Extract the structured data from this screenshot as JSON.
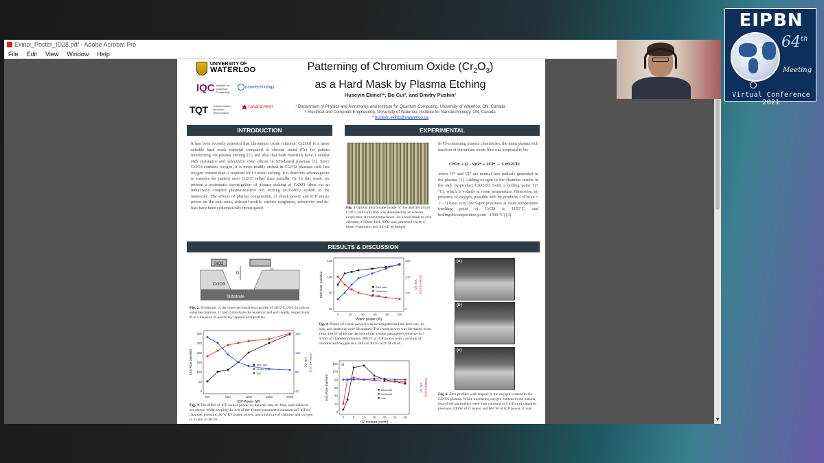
{
  "window": {
    "title": "Ekinci_Poster_ID28.pdf - Adobe Acrobat Pro",
    "menu": [
      "File",
      "Edit",
      "View",
      "Window",
      "Help"
    ]
  },
  "poster": {
    "title_line1": "Patterning of Chromium Oxide (Cr",
    "title_sub1": "2",
    "title_mid": "O",
    "title_sub2": "3",
    "title_end": ")",
    "title_line2": "as a Hard Mask by Plasma Etching",
    "authors": "Huseyin Ekinci¹*, Bo Cui², and Dmitry Pushin¹",
    "affil1": "¹ Department of Physics and Astronomy, and Institute for Quantum Computing, University of Waterloo, ON, Canada",
    "affil2": "² Electrical and Computer Engineering, University of Waterloo, Institute for Nanotechnology, ON, Canada",
    "email": "huseyin.ekinci@uwaterloo.ca",
    "logos": {
      "uw_small": "UNIVERSITY OF",
      "uw_big": "WATERLOO",
      "iqc": "IQC",
      "iqc_sub": "Institute for Quantum Computing",
      "nano": "nanotechnology",
      "tqt": "TQT",
      "tqt_sub": "Transformative Quantum Technologies",
      "cfref": "CANADA FIRST"
    },
    "intro_head": "INTRODUCTION",
    "intro_text": "It has been recently reported that chromium oxide (chrome, Cr2O3) is a more suitable hard mask material compared to chrome metal (Cr) for pattern transferring via plasma etching [1], and also that both materials have a similar etch resistance and selectivity over silicon in SF6-based plasmas [2]. Since Cr2O3 contains oxygen, it is more readily etched in Cl2/O2 plasmas with less oxygen content than is required for Cr metal etching. It is therefore advantageous to transfer the pattern onto Cr2O3 rather than metallic Cr. In this work, we present a systematic investigation of plasma etching of Cr2O3 films via an inductively coupled plasma-reactive ion etching (ICP-RIE) system in the nanoscale. The effects of plasma composition, rf chuck power and ICP source power on the etch rates, sidewall profile, surface roughness, selectivity and dc-bias have been systematically investigated.",
    "exp_head": "EXPERIMENTAL",
    "fig1_caption_bold": "Fig. 1",
    "fig1_caption": " Optical microscope image of line and dot arrays. Cr2O3 (500 nm) film was deposited by an e-beam evaporator at room temperature. As a hard mask to etch chromia, a 50nm-thick SiO2 was patterned via an e-beam evaporator and lift-off technique.",
    "exp_text1": "In Cl-containing plasma chemistries, the main plasma etch reaction of chromium oxide film was proposed to be:",
    "formula": "CrOx + (2 - x)O* + 2Cl* → CrO2Cl2",
    "exp_text2": "where O* and Cl* are neutral free radicals generated in the plasma [3]. Adding oxygen to the chamber results in the etch by-product CrO2Cl2 (with a boiling point 117 °C), which is volatile at room temperature. Otherwise, no presence of oxygen, possible etch by-products CrCln (n = 1 - 3) have very low vapor pressures at room temperature (melting point of CrCl3 is 1152°C, and boiling/decomposition point ~1300 °C) [3].",
    "results_head": "RESULTS & DISCUSSION",
    "fig2_caption_bold": "Fig. 2.",
    "fig2_caption": " Schematic of the cross-sectional etch profile of SiO2/Cr2O3 on silicon substrate features. U and D illustrate the undercut and etch depth, respectively. Θ is a measure of positively tapered etch profiles.",
    "fig3_caption_bold": "Fig. 3.",
    "fig3_caption": " The effect of ICP source power on the etch rate, dc-bias, and undercut are shown while keeping the rest of the system parameters constant at 5 mTorr chamber pressure, 20 W RF platen power, and a mixture of chlorine and oxygen in a ratio of 40:10",
    "fig4_caption_bold": "Fig. 4.",
    "fig4_caption": " Platen (rf chuck power) was investigated and the etch rate, dc bias, and undercut were illustrated. The chuck power was increased from 10 to 100 W while the the rest of the system parameters were set to 5 mTorr of chamber pressure, 600 W of ICP power with a mixture of chlorine and oxygen in a ratio of 40:10 sccm at 40 oC.",
    "fig6_caption_bold": "Fig. 6.",
    "fig6_caption": " Etch profiles with respect to the oxygen content in the Cl2/O2 plasma. While increasing oxygen content in the plasma, rest of the parameters were kept constant at 5 mTorr of chamber pressure, 100 W of rf power and 600 W of ICP power. It was",
    "fig2_labels": {
      "sio2": "SiO2",
      "cr2o3": "Cr2O3",
      "substrate": "Substrate",
      "d": "D",
      "u": "U"
    },
    "sem_labels": [
      "(a)",
      "(b)",
      "(c)"
    ]
  },
  "chart_data": [
    {
      "type": "line",
      "id": "fig3",
      "xlabel": "ICP Power (W)",
      "ylabel": "Etch Rate (nm/min)",
      "y2label": "Vdc (V)",
      "y3label": "Undercut (nm)",
      "x": [
        400,
        600,
        800,
        1000,
        1200,
        1600,
        2000
      ],
      "xticks": [
        "400",
        "800",
        "1200",
        "1600",
        "2000"
      ],
      "ylim": [
        0,
        300
      ],
      "yticks": [
        "0",
        "50",
        "100",
        "150",
        "200",
        "250",
        "300"
      ],
      "y2ticks": [
        "40",
        "80",
        "120",
        "160"
      ],
      "y3ticks": [
        "0",
        "20",
        "40",
        "60"
      ],
      "series": [
        {
          "name": "Etch rate",
          "color": "#111111",
          "values": [
            50,
            100,
            110,
            150,
            200,
            250,
            295
          ]
        },
        {
          "name": "Undercut",
          "color": "#e02020",
          "values": [
            180,
            210,
            240,
            250,
            260,
            270,
            300
          ]
        },
        {
          "name": "Vdc",
          "color": "#1f3fe0",
          "values": [
            280,
            250,
            190,
            150,
            130,
            115,
            110
          ]
        }
      ]
    },
    {
      "type": "line",
      "id": "fig4",
      "xlabel": "Platen power (W)",
      "ylabel": "Etch Rate (nm/min)",
      "y2label": "Vdc (V)",
      "y3label": "Undercut (nm)",
      "x": [
        10,
        20,
        30,
        40,
        60,
        80,
        100
      ],
      "xticks": [
        "0",
        "20",
        "40",
        "60",
        "80",
        "100"
      ],
      "ylim": [
        60,
        120
      ],
      "yticks": [
        "60",
        "80",
        "100",
        "120"
      ],
      "y2ticks": [
        "0",
        "100",
        "200",
        "300"
      ],
      "y3ticks": [
        "30",
        "60",
        "90"
      ],
      "series": [
        {
          "name": "Etch rate",
          "color": "#111111",
          "values": [
            90,
            104,
            106,
            108,
            110,
            112,
            115
          ]
        },
        {
          "name": "Undercut",
          "color": "#e02020",
          "values": [
            100,
            90,
            84,
            80,
            76,
            74,
            72
          ]
        },
        {
          "name": "Vdc",
          "color": "#1f3fe0",
          "values": [
            72,
            80,
            90,
            98,
            104,
            110,
            116
          ]
        }
      ]
    },
    {
      "type": "line",
      "id": "fig5",
      "panel": "a)",
      "xlabel": "O2 content (sccm)",
      "ylabel": "Etch Rate (nm/min)",
      "y2label": "Vdc (V)",
      "y3label": "Undercut (nm)",
      "x": [
        0,
        2,
        5,
        10,
        15,
        20,
        25,
        30
      ],
      "xticks": [
        "0",
        "5",
        "10",
        "15",
        "20",
        "25",
        "30"
      ],
      "ylim": [
        0,
        120
      ],
      "yticks": [
        "0",
        "20",
        "40",
        "60",
        "80",
        "100",
        "120"
      ],
      "series": [
        {
          "name": "Etch rate",
          "color": "#111111",
          "values": [
            5,
            30,
            110,
            115,
            90,
            80,
            75,
            70
          ]
        },
        {
          "name": "Undercut",
          "color": "#e02020",
          "values": [
            20,
            80,
            85,
            80,
            78,
            76,
            75,
            74
          ]
        },
        {
          "name": "Vdc",
          "color": "#1f3fe0",
          "values": [
            80,
            80,
            80,
            80,
            82,
            82,
            80,
            80
          ]
        }
      ]
    }
  ],
  "eipbn": {
    "title": "EIPBN",
    "number": "64",
    "suffix": "th",
    "meeting": "Meeting",
    "virtual": "Virtual Conference 2021"
  }
}
